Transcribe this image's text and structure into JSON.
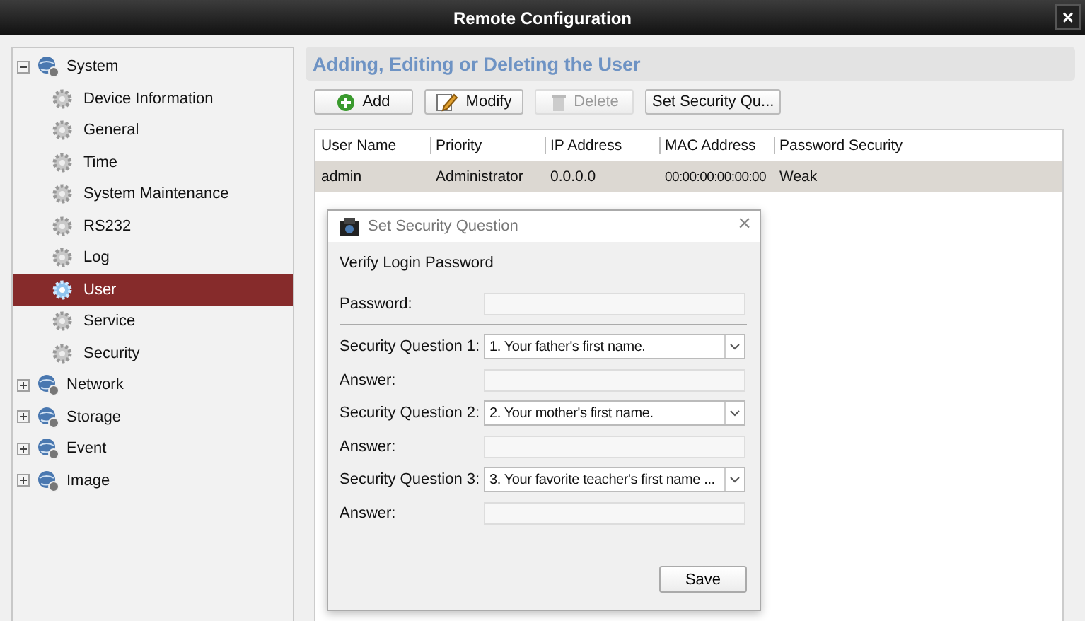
{
  "window": {
    "title": "Remote Configuration",
    "close": "×"
  },
  "tree": [
    {
      "label": "System",
      "expanded": true,
      "selected": false,
      "children": [
        {
          "label": "Device Information",
          "selected": false
        },
        {
          "label": "General",
          "selected": false
        },
        {
          "label": "Time",
          "selected": false
        },
        {
          "label": "System Maintenance",
          "selected": false
        },
        {
          "label": "RS232",
          "selected": false
        },
        {
          "label": "Log",
          "selected": false
        },
        {
          "label": "User",
          "selected": true
        },
        {
          "label": "Service",
          "selected": false
        },
        {
          "label": "Security",
          "selected": false
        }
      ]
    },
    {
      "label": "Network",
      "expanded": false,
      "selected": false
    },
    {
      "label": "Storage",
      "expanded": false,
      "selected": false
    },
    {
      "label": "Event",
      "expanded": false,
      "selected": false
    },
    {
      "label": "Image",
      "expanded": false,
      "selected": false
    }
  ],
  "panel": {
    "title": "Adding, Editing or Deleting the User"
  },
  "toolbar": [
    {
      "label": "Add",
      "kind": "add",
      "disabled": false
    },
    {
      "label": "Modify",
      "kind": "modify",
      "disabled": false
    },
    {
      "label": "Delete",
      "kind": "delete",
      "disabled": true
    },
    {
      "label": "Set Security Qu...",
      "kind": "text",
      "disabled": false
    }
  ],
  "table": {
    "columns": [
      "User Name",
      "Priority",
      "IP Address",
      "MAC Address",
      "Password Security"
    ],
    "rows": [
      {
        "cells": [
          "admin",
          "Administrator",
          "0.0.0.0",
          "00:00:00:00:00:00",
          "Weak"
        ],
        "selected": true
      }
    ]
  },
  "dialog": {
    "title": "Set Security Question",
    "close": "×",
    "section": "Verify Login Password",
    "fields": [
      {
        "label": "Password:",
        "kind": "input",
        "divider_after": true
      },
      {
        "label": "Security Question 1:",
        "kind": "select",
        "value": "1. Your father's first name."
      },
      {
        "label": "Answer:",
        "kind": "input"
      },
      {
        "label": "Security Question 2:",
        "kind": "select",
        "value": "2. Your mother's first name."
      },
      {
        "label": "Answer:",
        "kind": "input"
      },
      {
        "label": "Security Question 3:",
        "kind": "select",
        "value": "3. Your favorite teacher's first name ..."
      },
      {
        "label": "Answer:",
        "kind": "input"
      }
    ],
    "save": "Save"
  }
}
